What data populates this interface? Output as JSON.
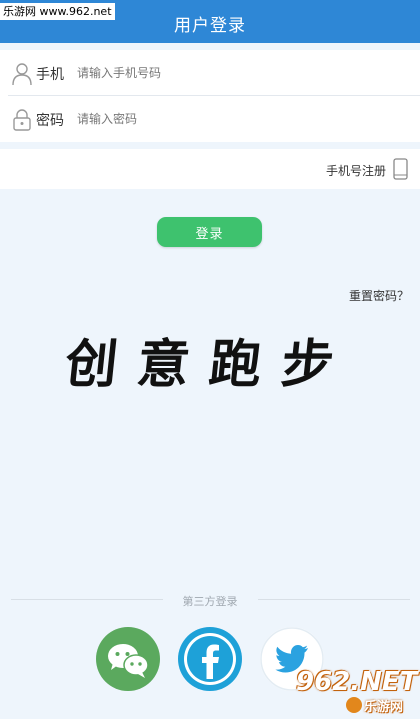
{
  "header": {
    "title": "用户登录"
  },
  "watermark_top": "乐游网 www.962.net",
  "form": {
    "phone": {
      "label": "手机",
      "placeholder": "请输入手机号码",
      "value": ""
    },
    "password": {
      "label": "密码",
      "placeholder": "请输入密码",
      "value": ""
    }
  },
  "register": {
    "label": "手机号注册"
  },
  "login_button": {
    "label": "登录"
  },
  "reset_password": {
    "label": "重置密码？"
  },
  "brand": {
    "text": "创意跑步"
  },
  "third_party": {
    "label": "第三方登录",
    "providers": [
      "wechat",
      "facebook",
      "twitter"
    ]
  },
  "watermark_bottom": {
    "brand": "962.NET",
    "caption": "乐游网"
  },
  "colors": {
    "header": "#2e87d6",
    "background": "#eef5fc",
    "login_button": "#3ec26e",
    "wechat": "#5ba95e",
    "facebook": "#1ea1d8",
    "twitter": "#2ba2e0"
  }
}
